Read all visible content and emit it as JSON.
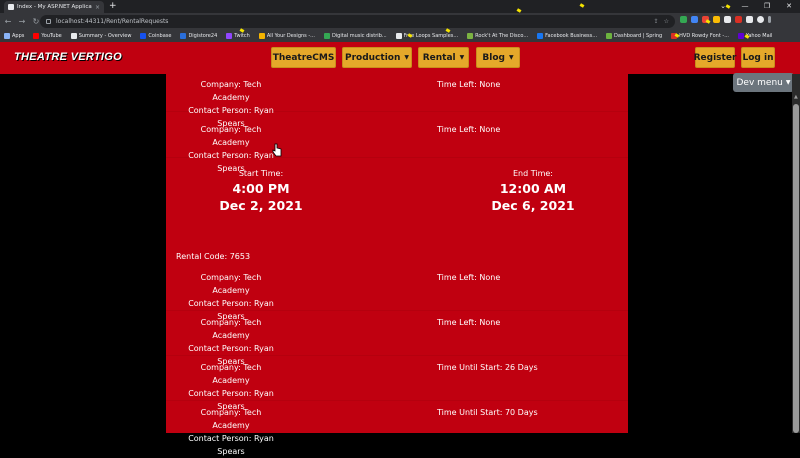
{
  "browser": {
    "tab_title": "Index - My ASP.NET Application",
    "tab_close": "×",
    "new_tab": "+",
    "url": "localhost:44311/Rent/RentalRequests",
    "window_controls": [
      "⌄",
      "—",
      "❐",
      "✕"
    ],
    "bookmarks": [
      {
        "label": "Apps",
        "color": "#8ab4f8"
      },
      {
        "label": "YouTube",
        "color": "#ff0000"
      },
      {
        "label": "Summary - Overview",
        "color": "#e8eaed"
      },
      {
        "label": "Coinbase",
        "color": "#1652f0"
      },
      {
        "label": "Digistore24",
        "color": "#2a6fdb"
      },
      {
        "label": "Twitch",
        "color": "#9146ff"
      },
      {
        "label": "All Your Designs -...",
        "color": "#f4b400"
      },
      {
        "label": "Digital music distrib...",
        "color": "#34a853"
      },
      {
        "label": "Free Loops Samples...",
        "color": "#e8eaed"
      },
      {
        "label": "Rock't At The Disco...",
        "color": "#7cb342"
      },
      {
        "label": "Facebook Business...",
        "color": "#1877f2"
      },
      {
        "label": "Dashboard | Spring",
        "color": "#6db33f"
      },
      {
        "label": "HVD Rowdy Font -...",
        "color": "#d93025"
      },
      {
        "label": "Yahoo Mail",
        "color": "#6001d2"
      }
    ]
  },
  "nav": {
    "brand": "THEATRE VERTIGO",
    "items": [
      {
        "label": "TheatreCMS",
        "dropdown": false
      },
      {
        "label": "Production",
        "dropdown": true
      },
      {
        "label": "Rental",
        "dropdown": true
      },
      {
        "label": "Blog",
        "dropdown": true
      }
    ],
    "register": "Register",
    "login": "Log in",
    "dev_menu": "Dev menu",
    "accent_color": "#e5a82a",
    "brand_color": "#c00010"
  },
  "rentals": {
    "block1": [
      {
        "company": "Company: Tech Academy",
        "contact": "Contact Person: Ryan Spears",
        "status": "Time Left: None"
      },
      {
        "company": "Company: Tech Academy",
        "contact": "Contact Person: Ryan Spears",
        "status": "Time Left: None"
      }
    ],
    "start_label": "Start Time:",
    "start_time": "4:00 PM",
    "start_date": "Dec 2, 2021",
    "end_label": "End Time:",
    "end_time": "12:00 AM",
    "end_date": "Dec 6, 2021",
    "rental_code": "Rental Code: 7653",
    "block2": [
      {
        "company": "Company: Tech Academy",
        "contact": "Contact Person: Ryan Spears",
        "status": "Time Left: None"
      },
      {
        "company": "Company: Tech Academy",
        "contact": "Contact Person: Ryan Spears",
        "status": "Time Left: None"
      },
      {
        "company": "Company: Tech Academy",
        "contact": "Contact Person: Ryan Spears",
        "status": "Time Until Start: 26 Days"
      },
      {
        "company": "Company: Tech Academy",
        "contact": "Contact Person: Ryan Spears",
        "status": "Time Until Start: 70 Days"
      }
    ]
  }
}
